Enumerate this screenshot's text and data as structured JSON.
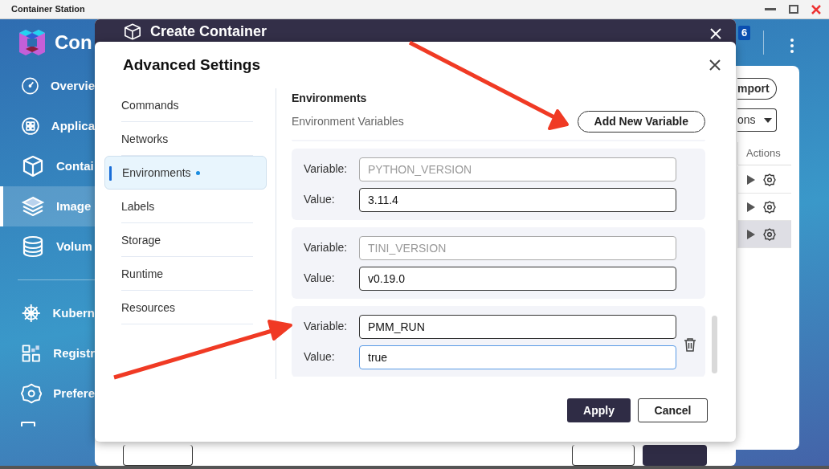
{
  "window": {
    "title": "Container Station"
  },
  "sidebar": {
    "brand": "Con",
    "items": [
      {
        "label": "Overvie",
        "selected": false,
        "separated": false
      },
      {
        "label": "Applica",
        "selected": false,
        "separated": false
      },
      {
        "label": "Contai",
        "selected": false,
        "separated": false
      },
      {
        "label": "Image",
        "selected": true,
        "separated": false
      },
      {
        "label": "Volum",
        "selected": false,
        "separated": false
      },
      {
        "label": "Kubern",
        "selected": false,
        "separated": true
      },
      {
        "label": "Registr",
        "selected": false,
        "separated": false
      },
      {
        "label": "Prefere",
        "selected": false,
        "separated": false
      }
    ]
  },
  "header": {
    "notification_count": "6"
  },
  "panel": {
    "import_button": "mport",
    "filter_dropdown": "ons",
    "table": {
      "columns": [
        "Actions"
      ],
      "rows": [
        {
          "selected": false
        },
        {
          "selected": false
        },
        {
          "selected": true
        }
      ]
    }
  },
  "create_dialog": {
    "title": "Create Container"
  },
  "advanced_settings": {
    "title": "Advanced Settings",
    "nav": [
      {
        "label": "Commands",
        "selected": false,
        "modified": false
      },
      {
        "label": "Networks",
        "selected": false,
        "modified": false
      },
      {
        "label": "Environments",
        "selected": true,
        "modified": true
      },
      {
        "label": "Labels",
        "selected": false,
        "modified": false
      },
      {
        "label": "Storage",
        "selected": false,
        "modified": false
      },
      {
        "label": "Runtime",
        "selected": false,
        "modified": false
      },
      {
        "label": "Resources",
        "selected": false,
        "modified": false
      }
    ],
    "section_title": "Environments",
    "subtitle": "Environment Variables",
    "add_button": "Add New Variable",
    "variables": [
      {
        "variable_label": "Variable:",
        "variable": "PYTHON_VERSION",
        "value_label": "Value:",
        "value": "3.11.4",
        "editable": false,
        "focused": false,
        "deletable": false
      },
      {
        "variable_label": "Variable:",
        "variable": "TINI_VERSION",
        "value_label": "Value:",
        "value": "v0.19.0",
        "editable": false,
        "focused": false,
        "deletable": false
      },
      {
        "variable_label": "Variable:",
        "variable": "PMM_RUN",
        "value_label": "Value:",
        "value": "true",
        "editable": true,
        "focused": true,
        "deletable": true
      }
    ],
    "buttons": [
      {
        "label": "Apply",
        "kind": "primary"
      },
      {
        "label": "Cancel",
        "kind": "secondary"
      }
    ]
  }
}
